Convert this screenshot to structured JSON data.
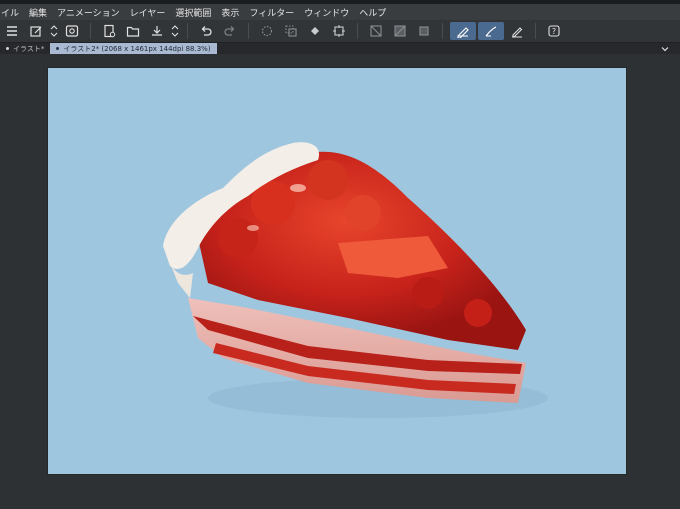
{
  "menu": {
    "items": [
      "イル",
      "編集",
      "アニメーション",
      "レイヤー",
      "選択範囲",
      "表示",
      "フィルター",
      "ウィンドウ",
      "ヘルプ"
    ]
  },
  "tabs": [
    {
      "label": "イラスト*"
    },
    {
      "label": "イラスト2* (2068 x 1461px 144dpi 88.3%)"
    }
  ],
  "colors": {
    "canvas_bg": "#9fc6df",
    "accent": "#4b6a8f"
  },
  "icons": {
    "toolbar": [
      "menu-icon",
      "new-document-icon",
      "open-file-icon",
      "save-icon",
      "undo-icon",
      "redo-icon",
      "selection-tools-icon",
      "pen-tool-icon"
    ]
  }
}
